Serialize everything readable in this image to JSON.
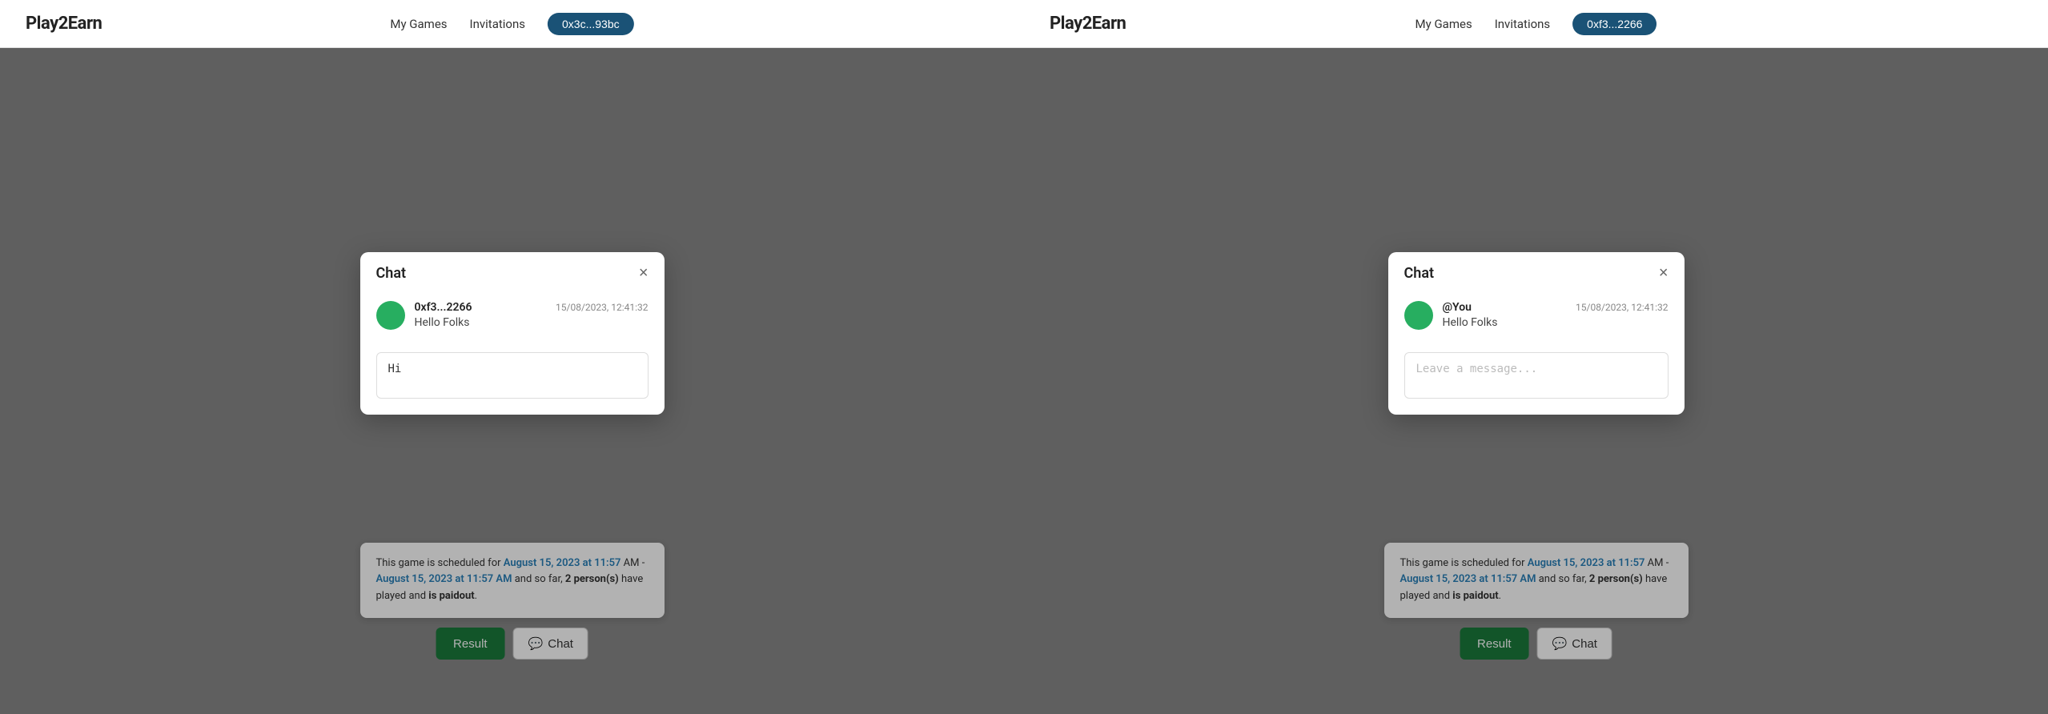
{
  "left_panel": {
    "logo": "Play2Earn",
    "nav": {
      "my_games": "My Games",
      "invitations": "Invitations",
      "wallet": "0x3c...93bc"
    },
    "chat_modal": {
      "title": "Chat",
      "message": {
        "sender": "0xf3...2266",
        "text": "Hello Folks",
        "timestamp": "15/08/2023, 12:41:32"
      },
      "input_value": "Hi",
      "close_label": "×"
    },
    "game_info": {
      "text_prefix": "This game is scheduled for",
      "date1": "August 15, 2023 at 11:57 AM",
      "text_middle": "- August 15, 2023 at 11:57 AM and so far,",
      "persons": "2 person(s)",
      "text_suffix": "have played and",
      "paidout": "is paidout",
      "period": "."
    },
    "actions": {
      "result": "Result",
      "chat": "Chat",
      "chat_icon": "💬"
    }
  },
  "right_panel": {
    "logo": "Play2Earn",
    "nav": {
      "my_games": "My Games",
      "invitations": "Invitations",
      "wallet": "0xf3...2266"
    },
    "chat_modal": {
      "title": "Chat",
      "message": {
        "sender": "@You",
        "text": "Hello Folks",
        "timestamp": "15/08/2023, 12:41:32"
      },
      "input_placeholder": "Leave a message...",
      "close_label": "×"
    },
    "game_info": {
      "text_prefix": "This game is scheduled for",
      "date1": "August 15, 2023 at 11:57 AM",
      "text_middle": "- August 15, 2023 at 11:57 AM and so far,",
      "persons": "2 person(s)",
      "text_suffix": "have played and",
      "paidout": "is paidout",
      "period": "."
    },
    "actions": {
      "result": "Result",
      "chat": "Chat",
      "chat_icon": "💬"
    }
  }
}
